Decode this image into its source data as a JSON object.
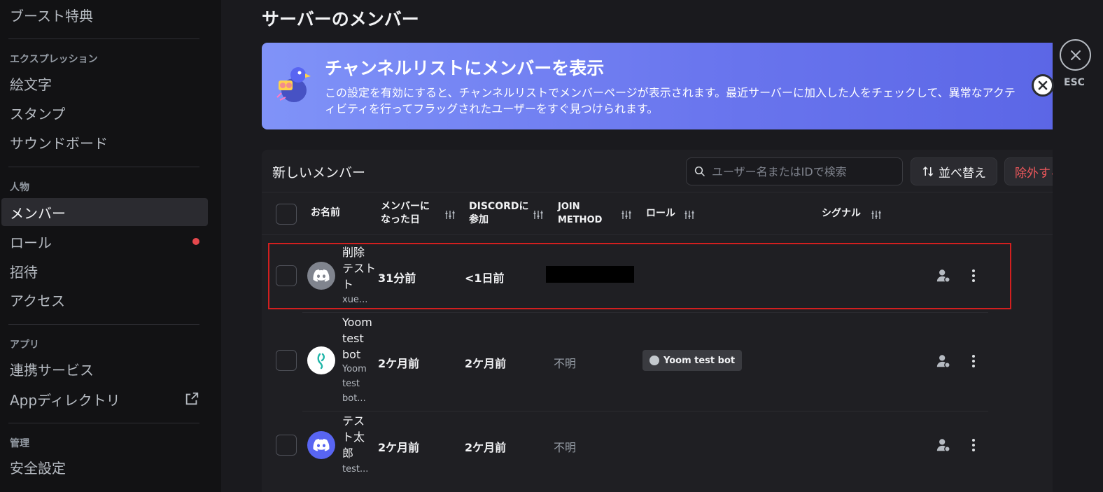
{
  "sidebar": {
    "boost_label": "ブースト特典",
    "expression_header": "エクスプレッション",
    "emoji_label": "絵文字",
    "stamp_label": "スタンプ",
    "soundboard_label": "サウンドボード",
    "people_header": "人物",
    "members_label": "メンバー",
    "roles_label": "ロール",
    "invites_label": "招待",
    "access_label": "アクセス",
    "apps_header": "アプリ",
    "integrations_label": "連携サービス",
    "app_directory_label": "Appディレクトリ",
    "moderation_header": "管理",
    "safety_label": "安全設定"
  },
  "page": {
    "title": "サーバーのメンバー"
  },
  "banner": {
    "title": "チャンネルリストにメンバーを表示",
    "description": "この設定を有効にすると、チャンネルリストでメンバーページが表示されます。最近サーバーに加入した人をチェックして、異常なアクティビティを行ってフラッグされたユーザーをすぐ見つけられます。"
  },
  "close": {
    "esc_label": "ESC"
  },
  "members_panel": {
    "title": "新しいメンバー",
    "search_placeholder": "ユーザー名またはIDで検索",
    "sort_label": "並べ替え",
    "exclude_label": "除外する"
  },
  "table": {
    "col_name": "お名前",
    "col_member_since_1": "メンバーに",
    "col_member_since_2": "なった日",
    "col_discord_1": "DISCORDに",
    "col_discord_2": "参加",
    "col_join_1": "JOIN",
    "col_join_2": "METHOD",
    "col_roles": "ロール",
    "col_signals": "シグナル",
    "rows": [
      {
        "name_lines": [
          "削除",
          "テスト",
          "ト"
        ],
        "username": "xue...",
        "member_since": "31分前",
        "discord_joined": "<1日前",
        "join_method": "",
        "role": "",
        "avatar_color": "#80848e"
      },
      {
        "name_lines": [
          "Yoom",
          "test",
          "bot"
        ],
        "username_lines": [
          "Yoom",
          "test",
          "bot..."
        ],
        "member_since": "2ケ月前",
        "discord_joined": "2ケ月前",
        "join_method": "不明",
        "role": "Yoom test bot",
        "avatar_color": "#ffffff"
      },
      {
        "name_lines": [
          "テス",
          "ト太",
          "郎"
        ],
        "username": "test...",
        "member_since": "2ケ月前",
        "discord_joined": "2ケ月前",
        "join_method": "不明",
        "role": "",
        "avatar_color": "#5865f2"
      }
    ]
  },
  "colors": {
    "accent": "#5865f2",
    "danger": "#f0585c",
    "highlight_border": "#d21f1f"
  }
}
